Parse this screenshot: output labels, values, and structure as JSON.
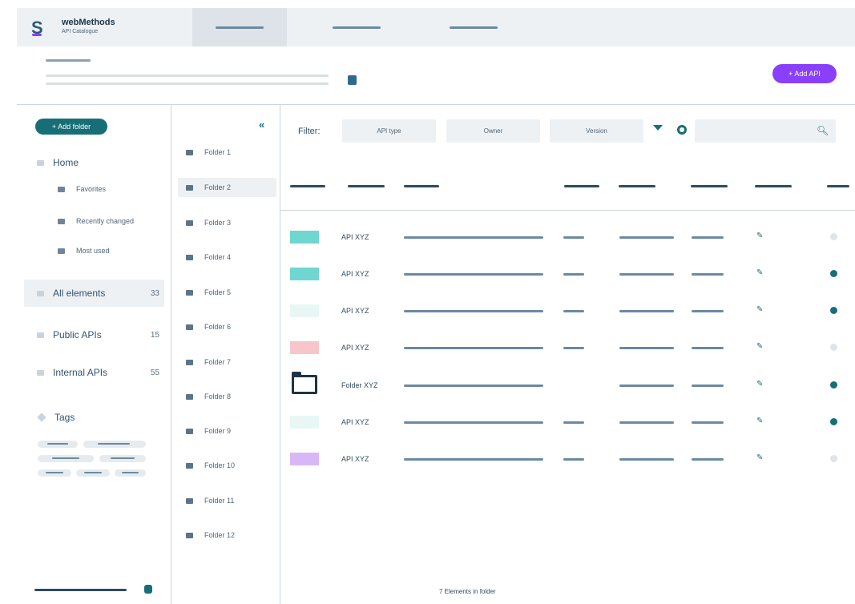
{
  "app": {
    "logo_glyph": "S",
    "brand_name": "webMethods",
    "brand_sub": "API Catalogue"
  },
  "header": {
    "add_button_label": "+ Add API"
  },
  "sidebar": {
    "add_folder_label": "+ Add folder",
    "home_label": "Home",
    "home_children": [
      {
        "label": "Favorites"
      },
      {
        "label": "Recently changed"
      },
      {
        "label": "Most used"
      }
    ],
    "collections": [
      {
        "label": "All elements",
        "count": "33"
      },
      {
        "label": "Public APIs",
        "count": "15"
      },
      {
        "label": "Internal APIs",
        "count": "55"
      }
    ],
    "tags_label": "Tags"
  },
  "folders": {
    "collapse_glyph": "«",
    "items": [
      {
        "label": "Folder 1"
      },
      {
        "label": "Folder 2"
      },
      {
        "label": "Folder 3"
      },
      {
        "label": "Folder 4"
      },
      {
        "label": "Folder 5"
      },
      {
        "label": "Folder 6"
      },
      {
        "label": "Folder 7"
      },
      {
        "label": "Folder 8"
      },
      {
        "label": "Folder 9"
      },
      {
        "label": "Folder 10"
      },
      {
        "label": "Folder 11"
      },
      {
        "label": "Folder 12"
      }
    ]
  },
  "filters": {
    "label": "Filter:",
    "api_type": "API type",
    "owner": "Owner",
    "version": "Version",
    "search_placeholder": "",
    "search_glyph": "🔍︎"
  },
  "table": {
    "rows": [
      {
        "name": "API XYZ",
        "swatch": "#6fd6d0",
        "kind": "api",
        "status": "#dfe4e8"
      },
      {
        "name": "API XYZ",
        "swatch": "#6fd6d0",
        "kind": "api",
        "status": "#176e76"
      },
      {
        "name": "API XYZ",
        "swatch": "#e8f7f6",
        "kind": "api",
        "status": "#176e76"
      },
      {
        "name": "API XYZ",
        "swatch": "#f6c6ca",
        "kind": "api",
        "status": "#dfe4e8"
      },
      {
        "name": "Folder XYZ",
        "swatch": "",
        "kind": "folder",
        "status": "#176e76"
      },
      {
        "name": "API XYZ",
        "swatch": "#e8f7f6",
        "kind": "api",
        "status": "#176e76"
      },
      {
        "name": "API XYZ",
        "swatch": "#d9b7f7",
        "kind": "api",
        "status": "#dfe4e8"
      }
    ],
    "edit_glyph": "✎"
  },
  "footer": {
    "count_text": "7 Elements in folder"
  },
  "colors": {
    "accent_purple": "#8a3ffc",
    "accent_teal": "#176e76"
  }
}
